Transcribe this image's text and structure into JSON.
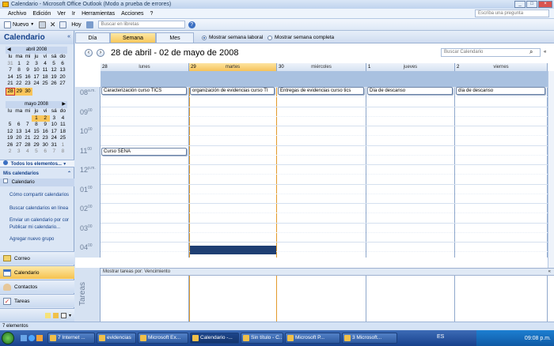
{
  "window": {
    "title": "Calendario - Microsoft Office Outlook (Modo a prueba de errores)"
  },
  "menu": {
    "items": [
      "Archivo",
      "Edición",
      "Ver",
      "Ir",
      "Herramientas",
      "Acciones",
      "?"
    ],
    "help_placeholder": "Escriba una pregunta"
  },
  "toolbar": {
    "new_label": "Nuevo",
    "today_label": "Hoy",
    "search_books_placeholder": "Buscar en libretas"
  },
  "nav": {
    "title": "Calendario",
    "april": {
      "title": "abril 2008",
      "dow": [
        "lu",
        "ma",
        "mi",
        "ju",
        "vi",
        "sá",
        "do"
      ],
      "weeks": [
        [
          "31",
          "1",
          "2",
          "3",
          "4",
          "5",
          "6"
        ],
        [
          "7",
          "8",
          "9",
          "10",
          "11",
          "12",
          "13"
        ],
        [
          "14",
          "15",
          "16",
          "17",
          "18",
          "19",
          "20"
        ],
        [
          "21",
          "22",
          "23",
          "24",
          "25",
          "26",
          "27"
        ],
        [
          "28",
          "29",
          "30",
          "",
          "",
          "",
          ""
        ]
      ]
    },
    "may": {
      "title": "mayo 2008",
      "dow": [
        "lu",
        "ma",
        "mi",
        "ju",
        "vi",
        "sá",
        "do"
      ],
      "weeks": [
        [
          "",
          "",
          "",
          "1",
          "2",
          "3",
          "4"
        ],
        [
          "5",
          "6",
          "7",
          "8",
          "9",
          "10",
          "11"
        ],
        [
          "12",
          "13",
          "14",
          "15",
          "16",
          "17",
          "18"
        ],
        [
          "19",
          "20",
          "21",
          "22",
          "23",
          "24",
          "25"
        ],
        [
          "26",
          "27",
          "28",
          "29",
          "30",
          "31",
          "1"
        ],
        [
          "2",
          "3",
          "4",
          "5",
          "6",
          "7",
          "8"
        ]
      ]
    },
    "all_items": "Todos los elementos...",
    "my_calendars": "Mis calendarios",
    "calendar_item": "Calendario",
    "links": [
      "Cómo compartir calendarios",
      "Buscar calendarios en línea",
      "Enviar un calendario por cor",
      "Publicar mi calendario...",
      "Agregar nuevo grupo"
    ],
    "buttons": [
      "Correo",
      "Calendario",
      "Contactos",
      "Tareas"
    ]
  },
  "views": {
    "tabs": [
      "Día",
      "Semana",
      "Mes"
    ],
    "active": "Semana",
    "radio_work_week": "Mostrar semana laboral",
    "radio_full_week": "Mostrar semana completa"
  },
  "header": {
    "date_range": "28 de abril - 02 de mayo de 2008",
    "search_placeholder": "Buscar Calendario"
  },
  "days": [
    {
      "num": "28",
      "name": "lunes"
    },
    {
      "num": "29",
      "name": "martes"
    },
    {
      "num": "30",
      "name": "miércoles"
    },
    {
      "num": "1",
      "name": "jueves"
    },
    {
      "num": "2",
      "name": "viernes"
    }
  ],
  "hours": [
    {
      "h": "08",
      "m": "a.m."
    },
    {
      "h": "09",
      "m": "00"
    },
    {
      "h": "10",
      "m": "00"
    },
    {
      "h": "11",
      "m": "00"
    },
    {
      "h": "12",
      "m": "p.m."
    },
    {
      "h": "01",
      "m": "00"
    },
    {
      "h": "02",
      "m": "00"
    },
    {
      "h": "03",
      "m": "00"
    },
    {
      "h": "04",
      "m": "00"
    }
  ],
  "appointments": [
    {
      "day": 0,
      "text": "Caracterización curso TICS"
    },
    {
      "day": 1,
      "text": "organización de evidencias curso TI"
    },
    {
      "day": 2,
      "text": "Entregas de evidencias curso tics"
    },
    {
      "day": 3,
      "text": "Día de descanso"
    },
    {
      "day": 4,
      "text": "día de descanso"
    },
    {
      "day": 0,
      "text": "Curso SENA"
    }
  ],
  "tasks": {
    "bar_label": "Mostrar tareas por: Vencimiento",
    "side_label": "Tareas"
  },
  "status": {
    "text": "7 elementos"
  },
  "taskbar": {
    "items": [
      "7 Internet ...",
      "evidencias",
      "Microsoft Ex...",
      "Calendario -...",
      "Sin título - C...",
      "Microsoft P...",
      "3 Microsoft..."
    ],
    "lang": "ES",
    "clock": "09:08 p.m."
  }
}
